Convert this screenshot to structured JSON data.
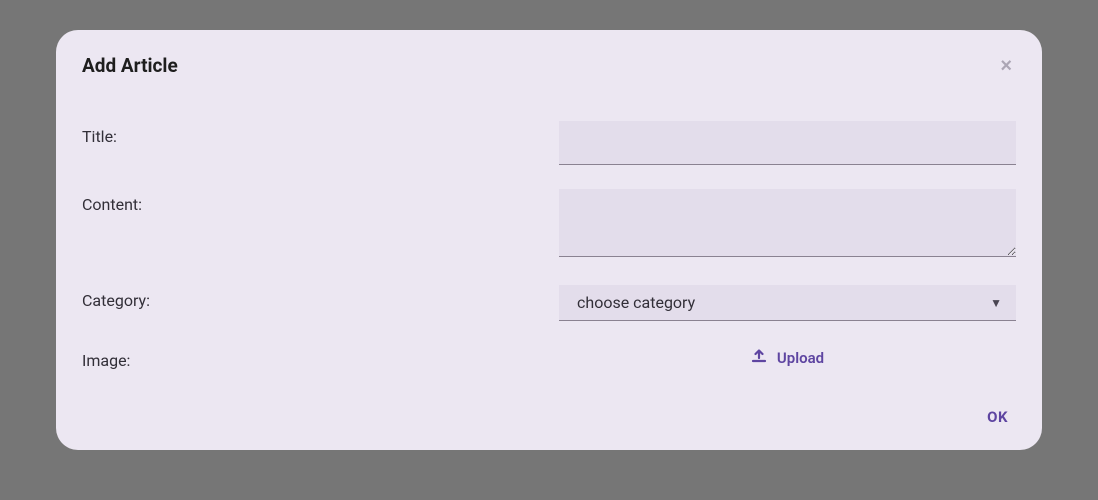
{
  "dialog": {
    "title": "Add Article",
    "close_symbol": "×"
  },
  "form": {
    "title": {
      "label": "Title:",
      "value": ""
    },
    "content": {
      "label": "Content:",
      "value": ""
    },
    "category": {
      "label": "Category:",
      "selected": "choose category"
    },
    "image": {
      "label": "Image:",
      "upload_label": "Upload"
    }
  },
  "footer": {
    "ok_label": "OK"
  }
}
